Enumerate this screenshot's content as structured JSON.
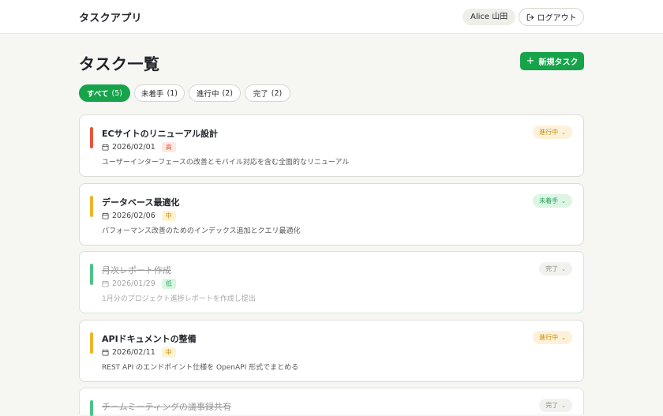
{
  "header": {
    "app_title": "タスクアプリ",
    "user": "Alice 山田",
    "logout_label": "ログアウト"
  },
  "main": {
    "title": "タスク一覧",
    "new_task_label": "新規タスク"
  },
  "filters": [
    {
      "label": "すべて",
      "count": "(5)",
      "active": true
    },
    {
      "label": "未着手",
      "count": "(1)",
      "active": false
    },
    {
      "label": "進行中",
      "count": "(2)",
      "active": false
    },
    {
      "label": "完了",
      "count": "(2)",
      "active": false
    }
  ],
  "tasks": [
    {
      "title": "ECサイトのリニューアル設計",
      "date": "2026/02/01",
      "priority": "高",
      "priority_level": "high",
      "description": "ユーザーインターフェースの改善とモバイル対応を含む全面的なリニューアル",
      "status": "進行中",
      "status_kind": "progress",
      "color": "#e8553a"
    },
    {
      "title": "データベース最適化",
      "date": "2026/02/06",
      "priority": "中",
      "priority_level": "mid",
      "description": "パフォーマンス改善のためのインデックス追加とクエリ最適化",
      "status": "未着手",
      "status_kind": "todo",
      "color": "#f0b429"
    },
    {
      "title": "月次レポート作成",
      "date": "2026/01/29",
      "priority": "低",
      "priority_level": "low",
      "description": "1月分のプロジェクト進捗レポートを作成し提出",
      "status": "完了",
      "status_kind": "complete",
      "color": "#4cc586"
    },
    {
      "title": "APIドキュメントの整備",
      "date": "2026/02/11",
      "priority": "中",
      "priority_level": "mid",
      "description": "REST API のエンドポイント仕様を OpenAPI 形式でまとめる",
      "status": "進行中",
      "status_kind": "progress",
      "color": "#f0b429"
    },
    {
      "title": "チームミーティングの議事録共有",
      "date": "",
      "priority": "",
      "priority_level": "",
      "description": "",
      "status": "完了",
      "status_kind": "complete",
      "color": "#4cc586"
    }
  ],
  "colors": {
    "accent": "#16a34a",
    "background": "#f6f6f3"
  }
}
